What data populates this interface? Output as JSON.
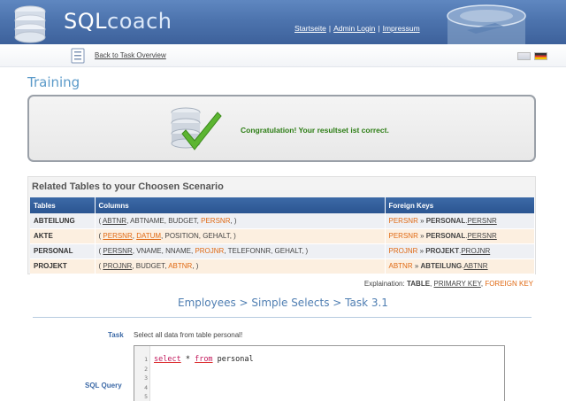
{
  "header": {
    "brand_sql": "SQL",
    "brand_coach": "coach",
    "nav": [
      "Startseite",
      "Admin Login",
      "Impressum"
    ],
    "separator": "|"
  },
  "subbar": {
    "back_link": "Back to Task Overview",
    "languages": [
      "english-flag-icon",
      "german-flag-icon"
    ]
  },
  "page_title": "Training",
  "result": {
    "message": "Congratulation! Your resultset ist correct.",
    "icon": "database-check-icon",
    "message_color": "#2c7d14"
  },
  "related": {
    "title": "Related Tables to your Choosen Scenario",
    "headers": [
      "Tables",
      "Columns",
      "Foreign Keys"
    ],
    "rows": [
      {
        "table": "ABTEILUNG",
        "columns": [
          {
            "name": "ABTNR",
            "pk": true,
            "fk": false
          },
          {
            "name": "ABTNAME",
            "pk": false,
            "fk": false
          },
          {
            "name": "BUDGET",
            "pk": false,
            "fk": false
          },
          {
            "name": "PERSNR",
            "pk": false,
            "fk": true
          }
        ],
        "fk_col": "PERSNR",
        "fk_table": "PERSONAL",
        "fk_ref": "PERSNR"
      },
      {
        "table": "AKTE",
        "columns": [
          {
            "name": "PERSNR",
            "pk": true,
            "fk": true
          },
          {
            "name": "DATUM",
            "pk": true,
            "fk": true
          },
          {
            "name": "POSITION",
            "pk": false,
            "fk": false
          },
          {
            "name": "GEHALT",
            "pk": false,
            "fk": false
          }
        ],
        "fk_col": "PERSNR",
        "fk_table": "PERSONAL",
        "fk_ref": "PERSNR"
      },
      {
        "table": "PERSONAL",
        "columns": [
          {
            "name": "PERSNR",
            "pk": true,
            "fk": false
          },
          {
            "name": "VNAME",
            "pk": false,
            "fk": false
          },
          {
            "name": "NNAME",
            "pk": false,
            "fk": false
          },
          {
            "name": "PROJNR",
            "pk": false,
            "fk": true
          },
          {
            "name": "TELEFONNR",
            "pk": false,
            "fk": false
          },
          {
            "name": "GEHALT",
            "pk": false,
            "fk": false
          }
        ],
        "fk_col": "PROJNR",
        "fk_table": "PROJEKT",
        "fk_ref": "PROJNR"
      },
      {
        "table": "PROJEKT",
        "columns": [
          {
            "name": "PROJNR",
            "pk": true,
            "fk": false
          },
          {
            "name": "BUDGET",
            "pk": false,
            "fk": false
          },
          {
            "name": "ABTNR",
            "pk": false,
            "fk": true
          }
        ],
        "fk_col": "ABTNR",
        "fk_table": "ABTEILUNG",
        "fk_ref": "ABTNR"
      }
    ],
    "explanation_label": "Explaination:",
    "legend_table": "TABLE",
    "legend_pk": "PRIMARY KEY",
    "legend_fk": "FOREIGN KEY"
  },
  "breadcrumb": "Employees > Simple Selects > Task 3.1",
  "task": {
    "label": "Task",
    "text": "Select all data from table personal!",
    "query_label": "SQL Query",
    "line_numbers": [
      "1",
      "2",
      "3",
      "4",
      "5"
    ],
    "query_kw1": "select",
    "query_star": " * ",
    "query_kw2": "from",
    "query_rest": " personal"
  },
  "colors": {
    "header": "#4d74ae",
    "accent": "#5b9ac9",
    "fk": "#e06a14",
    "table_header": "#2b5591"
  }
}
